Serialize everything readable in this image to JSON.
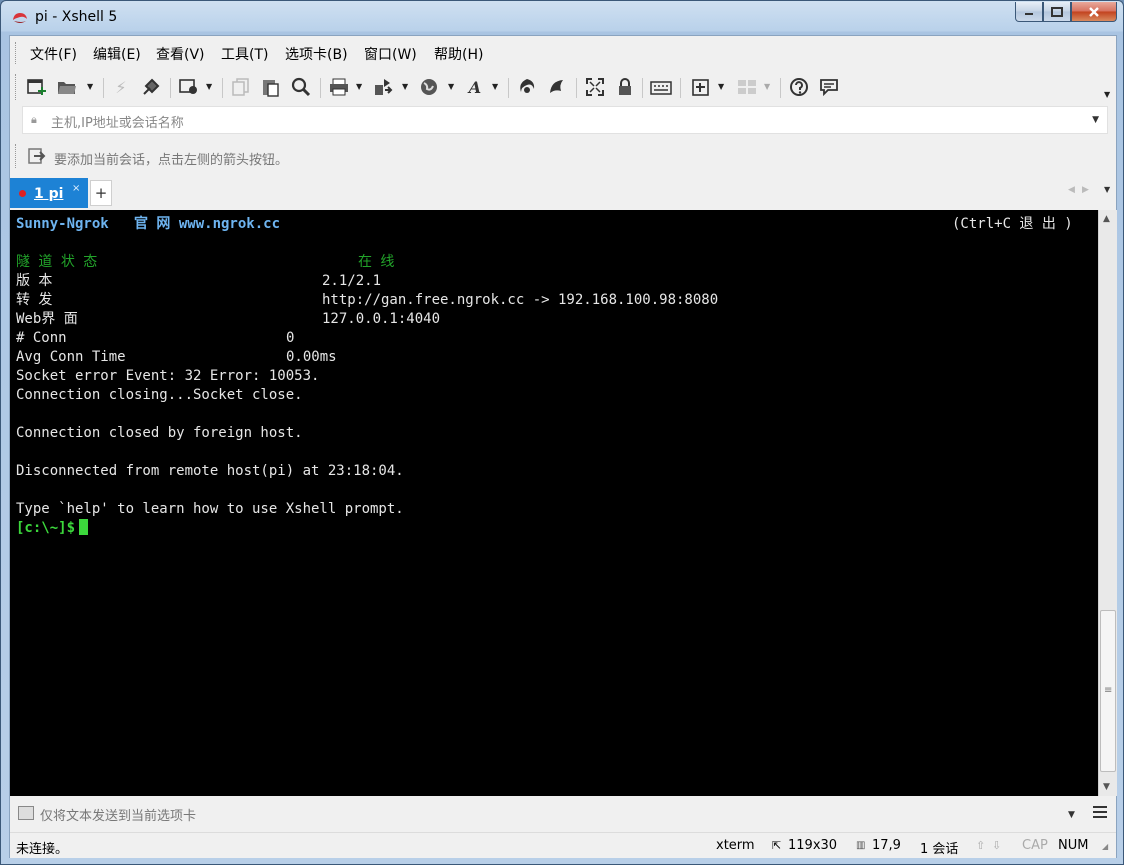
{
  "window": {
    "title": "pi - Xshell 5"
  },
  "menu": [
    "文件(F)",
    "编辑(E)",
    "查看(V)",
    "工具(T)",
    "选项卡(B)",
    "窗口(W)",
    "帮助(H)"
  ],
  "address": {
    "placeholder": "主机,IP地址或会话名称"
  },
  "session_hint": "要添加当前会话，点击左侧的箭头按钮。",
  "tab": {
    "label": "1 pi",
    "close": "×",
    "add": "+"
  },
  "terminal": {
    "header_left": "Sunny-Ngrok   官 网 www.ngrok.cc",
    "header_right": "(Ctrl+C 退 出 )",
    "status_label": "隧 道 状 态",
    "status_value": "在 线",
    "rows": [
      {
        "label": "版 本",
        "value": "2.1/2.1"
      },
      {
        "label": "转 发",
        "value": "http://gan.free.ngrok.cc -> 192.168.100.98:8080"
      },
      {
        "label": "Web界 面",
        "value": "127.0.0.1:4040"
      },
      {
        "label": "# Conn",
        "value": "0"
      },
      {
        "label": "Avg Conn Time",
        "value": "0.00ms"
      }
    ],
    "lines": [
      "Socket error Event: 32 Error: 10053.",
      "Connection closing...Socket close.",
      "Connection closed by foreign host.",
      "Disconnected from remote host(pi) at 23:18:04.",
      "Type `help' to learn how to use Xshell prompt."
    ],
    "prompt": "[c:\\~]$"
  },
  "compose": {
    "placeholder": "仅将文本发送到当前选项卡"
  },
  "status": {
    "connection": "未连接。",
    "term_type": "xterm",
    "size": "119x30",
    "cursor_pos": "17,9",
    "sessions": "1 会话",
    "caps": "CAP",
    "num": "NUM"
  }
}
